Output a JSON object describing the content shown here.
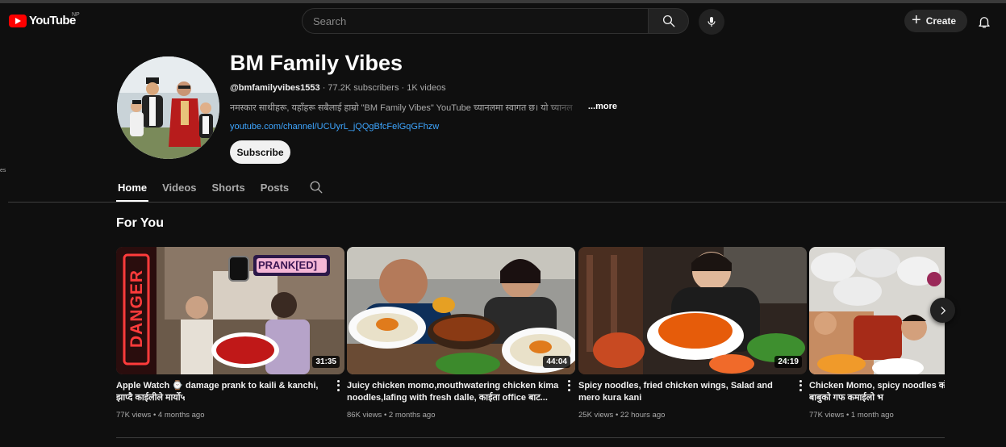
{
  "masthead": {
    "logo_text": "YouTube",
    "region": "NP",
    "search_placeholder": "Search",
    "create_label": "Create"
  },
  "edge_text": "es",
  "channel": {
    "name": "BM Family Vibes",
    "handle": "@bmfamilyvibes1553",
    "subscribers": "77.2K subscribers",
    "videos": "1K videos",
    "description": "नमस्कार साथीहरू, यहाँहरू सबैलाई हाम्रो \"BM Family Vibes\" YouTube च्यानलमा स्वागत छ। यो च्यानल",
    "more_label": "...more",
    "link": "youtube.com/channel/UCUyrL_jQQgBfcFelGqGFhzw",
    "subscribe_label": "Subscribe"
  },
  "tabs": [
    {
      "label": "Home",
      "active": true
    },
    {
      "label": "Videos",
      "active": false
    },
    {
      "label": "Shorts",
      "active": false
    },
    {
      "label": "Posts",
      "active": false
    }
  ],
  "section_title": "For You",
  "videos": [
    {
      "title": "Apple Watch ⌚ damage prank to kaili & kanchi, झाप्दै काईलीले मार्यो५",
      "duration": "31:35",
      "views": "77K views",
      "age": "4 months ago",
      "thumb_overlay_text": "PRANK[ED]",
      "thumb_sign_text": "DANGER"
    },
    {
      "title": "Juicy chicken momo,mouthwatering chicken kima noodles,lafing with fresh dalle, काईता office बाट...",
      "duration": "44:04",
      "views": "86K views",
      "age": "2 months ago"
    },
    {
      "title": "Spicy noodles, fried chicken wings, Salad and mero kura kani",
      "duration": "24:19",
      "views": "25K views",
      "age": "22 hours ago"
    },
    {
      "title": "Chicken Momo, spicy noodles को अनि छोरी। नानी बाबुको गफ कमाईलो भ",
      "duration": "",
      "views": "77K views",
      "age": "1 month ago"
    }
  ],
  "colors": {
    "background": "#0f0f0f",
    "brand_red": "#ff0000",
    "link_blue": "#3ea6ff",
    "text_primary": "#f1f1f1",
    "text_secondary": "#aaaaaa"
  }
}
